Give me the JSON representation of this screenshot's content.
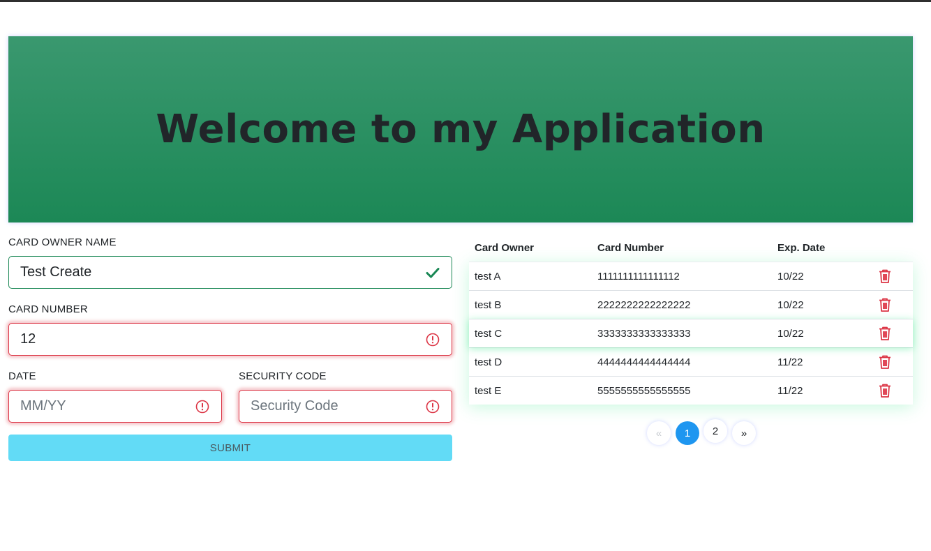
{
  "hero": {
    "title": "Welcome to my Application"
  },
  "form": {
    "owner": {
      "label": "CARD OWNER NAME",
      "value": "Test Create",
      "placeholder": ""
    },
    "number": {
      "label": "CARD NUMBER",
      "value": "12",
      "placeholder": ""
    },
    "date": {
      "label": "DATE",
      "value": "",
      "placeholder": "MM/YY"
    },
    "security": {
      "label": "SECURITY CODE",
      "value": "",
      "placeholder": "Security Code"
    },
    "submit_label": "SUBMIT"
  },
  "table": {
    "headers": [
      "Card Owner",
      "Card Number",
      "Exp. Date"
    ],
    "rows": [
      {
        "owner": "test A",
        "number": "1111111111111112",
        "date": "10/22"
      },
      {
        "owner": "test B",
        "number": "2222222222222222",
        "date": "10/22"
      },
      {
        "owner": "test C",
        "number": "3333333333333333",
        "date": "10/22"
      },
      {
        "owner": "test D",
        "number": "4444444444444444",
        "date": "11/22"
      },
      {
        "owner": "test E",
        "number": "5555555555555555",
        "date": "11/22"
      }
    ]
  },
  "pagination": {
    "prev": "«",
    "pages": [
      "1",
      "2"
    ],
    "active": "1",
    "next": "»"
  },
  "colors": {
    "valid": "#198754",
    "invalid": "#dc3545",
    "hero_top": "#3a986f",
    "hero_bottom": "#1c8856",
    "submit": "#62dbf6",
    "page_active": "#1e96f0"
  },
  "icons": {
    "valid": "checkmark-icon",
    "invalid": "exclamation-circle-icon",
    "delete": "trash-icon"
  }
}
